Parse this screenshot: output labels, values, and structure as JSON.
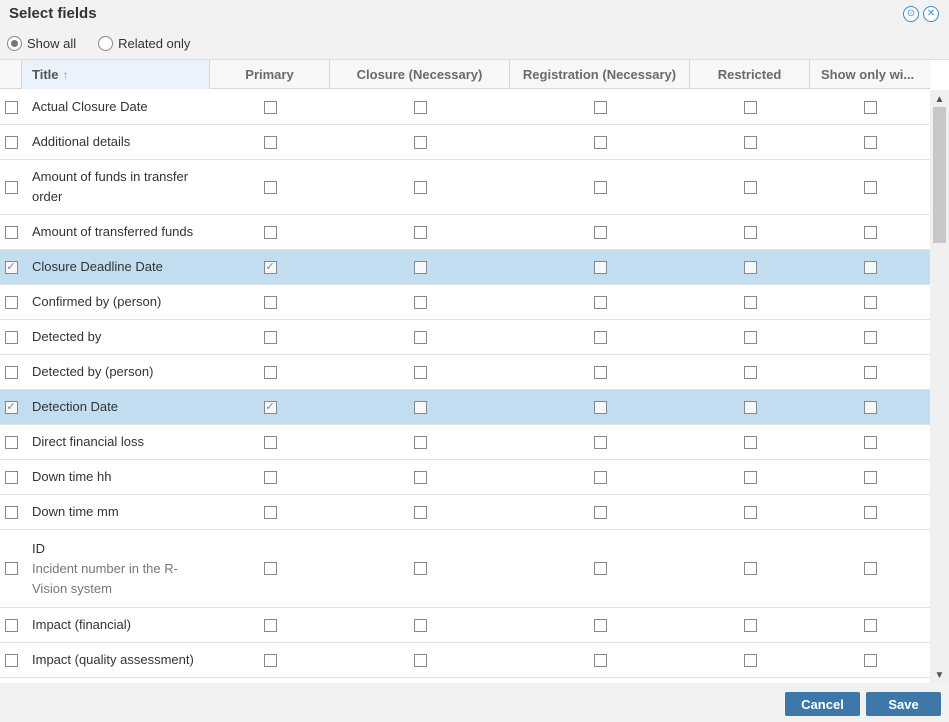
{
  "dialog": {
    "title": "Select fields"
  },
  "filter": {
    "show_all": "Show all",
    "related_only": "Related only",
    "selected": "show_all"
  },
  "columns": {
    "title": "Title",
    "primary": "Primary",
    "closure": "Closure (Necessary)",
    "registration": "Registration (Necessary)",
    "restricted": "Restricted",
    "show_only": "Show only wi..."
  },
  "rows": [
    {
      "name": "Actual Closure Date",
      "sub": "",
      "selected": false,
      "primary": false
    },
    {
      "name": "Additional details",
      "sub": "",
      "selected": false,
      "primary": false
    },
    {
      "name": "Amount of funds in transfer order",
      "sub": "",
      "selected": false,
      "primary": false
    },
    {
      "name": "Amount of transferred funds",
      "sub": "",
      "selected": false,
      "primary": false
    },
    {
      "name": "Closure Deadline Date",
      "sub": "",
      "selected": true,
      "primary": true
    },
    {
      "name": "Confirmed by (person)",
      "sub": "",
      "selected": false,
      "primary": false
    },
    {
      "name": "Detected by",
      "sub": "",
      "selected": false,
      "primary": false
    },
    {
      "name": "Detected by (person)",
      "sub": "",
      "selected": false,
      "primary": false
    },
    {
      "name": "Detection Date",
      "sub": "",
      "selected": true,
      "primary": true
    },
    {
      "name": "Direct financial loss",
      "sub": "",
      "selected": false,
      "primary": false
    },
    {
      "name": "Down time hh",
      "sub": "",
      "selected": false,
      "primary": false
    },
    {
      "name": "Down time mm",
      "sub": "",
      "selected": false,
      "primary": false
    },
    {
      "name": "ID",
      "sub": "Incident number in the R-Vision system",
      "selected": false,
      "primary": false
    },
    {
      "name": "Impact (financial)",
      "sub": "",
      "selected": false,
      "primary": false
    },
    {
      "name": "Impact (quality assessment)",
      "sub": "",
      "selected": false,
      "primary": false
    }
  ],
  "buttons": {
    "cancel": "Cancel",
    "save": "Save"
  },
  "colors": {
    "accent": "#3e78a8",
    "selected_row": "#c2dcf0",
    "icon": "#3a8ad0"
  },
  "icons": {
    "check": "✓",
    "sort_up": "↑",
    "scroll_up": "⌃",
    "scroll_down": "⌄"
  }
}
